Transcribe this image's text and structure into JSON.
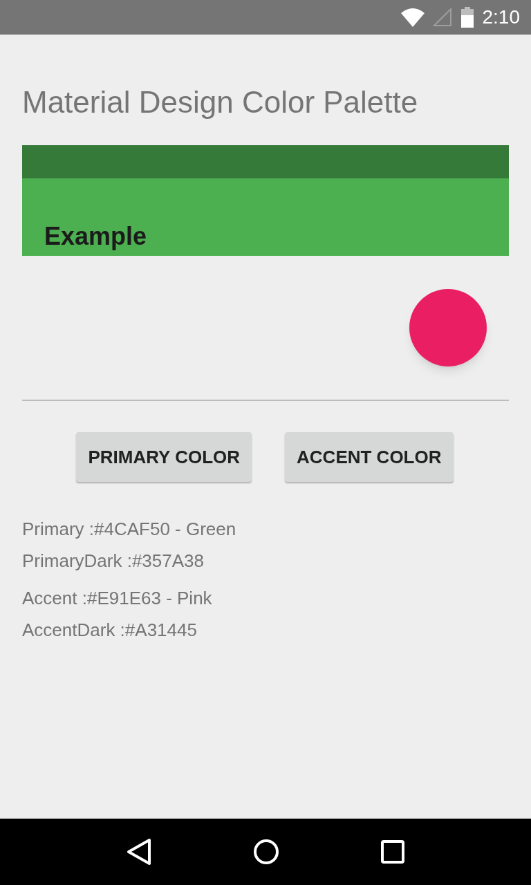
{
  "status_bar": {
    "time": "2:10"
  },
  "title": "Material Design Color Palette",
  "preview": {
    "title": "Example"
  },
  "buttons": [
    {
      "label": "PRIMARY COLOR"
    },
    {
      "label": "ACCENT COLOR"
    }
  ],
  "info_lines": [
    "Primary :#4CAF50 - Green",
    "PrimaryDark :#357A38",
    "Accent :#E91E63 - Pink",
    "AccentDark :#A31445"
  ]
}
